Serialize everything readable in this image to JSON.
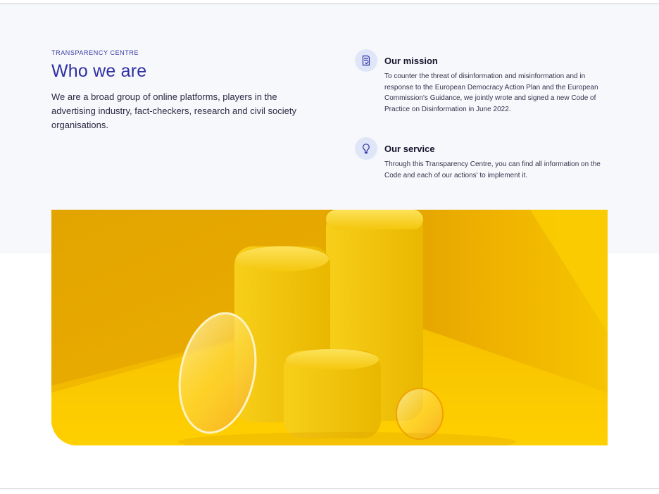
{
  "section": {
    "eyebrow": "TRANSPARENCY CENTRE",
    "title": "Who we are",
    "intro": "We are a broad group of online platforms, players in the advertising industry, fact-checkers, research and civil society organisations."
  },
  "features": {
    "mission": {
      "icon": "document-check-icon",
      "title": "Our mission",
      "text": "To counter the threat of disinformation and misinformation and in response to the European Democracy Action Plan and the European Commission's Guidance, we jointly wrote and signed a new Code of Practice on Disinformation in June 2022."
    },
    "service": {
      "icon": "lightbulb-icon",
      "title": "Our service",
      "text": "Through this Transparency Centre, you can find all information on the Code and each of our actions' to implement it."
    }
  },
  "colors": {
    "accent": "#2f2fa3",
    "icon_bg": "#dfe6f8",
    "hero_yellow": "#f4c10a"
  }
}
